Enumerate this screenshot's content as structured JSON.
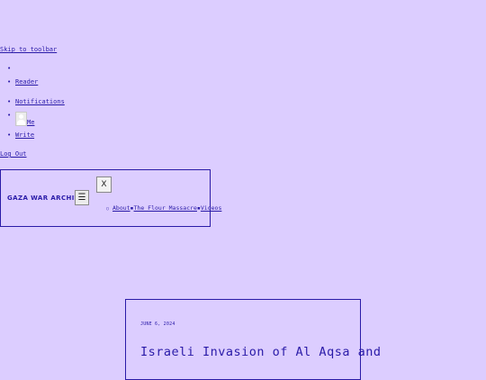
{
  "skip_link": "Skip to toolbar",
  "toolbar": {
    "items": [
      {
        "label": ""
      },
      {
        "label": "Reader"
      },
      {
        "label": "Notifications"
      },
      {
        "label": "Me"
      },
      {
        "label": "Write"
      }
    ],
    "logout": "Log Out"
  },
  "header": {
    "site_title": "GAZA WAR ARCHIVE",
    "menu_toggle_glyph": "☰",
    "close_glyph": "X",
    "nav": {
      "about": "About",
      "flour_massacre": "The Flour Massacre",
      "videos": "Videos"
    }
  },
  "post": {
    "date": "JUNE 6, 2024",
    "title": "Israeli Invasion of Al Aqsa and"
  },
  "colors": {
    "background": "#dccdff",
    "accent": "#2a1ba8"
  }
}
